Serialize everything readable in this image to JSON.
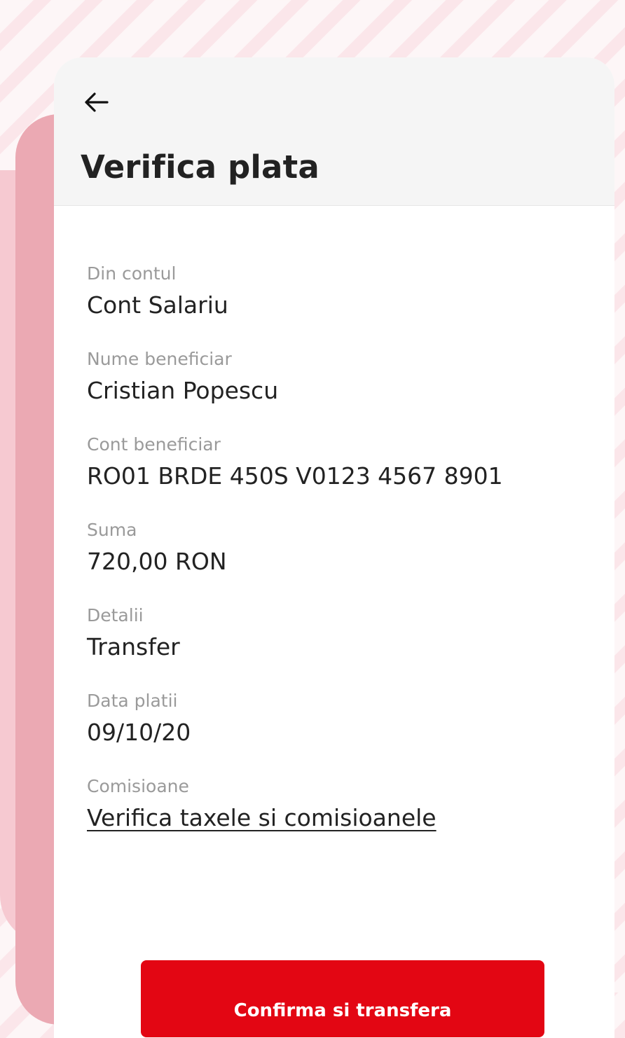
{
  "header": {
    "title": "Verifica plata",
    "back_icon": "arrow-left-icon"
  },
  "fields": [
    {
      "label": "Din contul",
      "value": "Cont Salariu"
    },
    {
      "label": "Nume beneficiar",
      "value": "Cristian Popescu"
    },
    {
      "label": "Cont beneficiar",
      "value": "RO01 BRDE 450S V0123 4567 8901"
    },
    {
      "label": "Suma",
      "value": "720,00 RON"
    },
    {
      "label": "Detalii",
      "value": "Transfer"
    },
    {
      "label": "Data platii",
      "value": "09/10/20"
    },
    {
      "label": "Comisioane",
      "link": "Verifica taxele si comisioanele"
    }
  ],
  "actions": {
    "confirm_label": "Confirma si transfera"
  },
  "colors": {
    "accent": "#e30613",
    "background_pink": "#eba9b3",
    "background_light_pink": "#f6c9d1",
    "header_bg": "#f5f5f5",
    "label_gray": "#9a9a9a",
    "text_dark": "#222222"
  }
}
